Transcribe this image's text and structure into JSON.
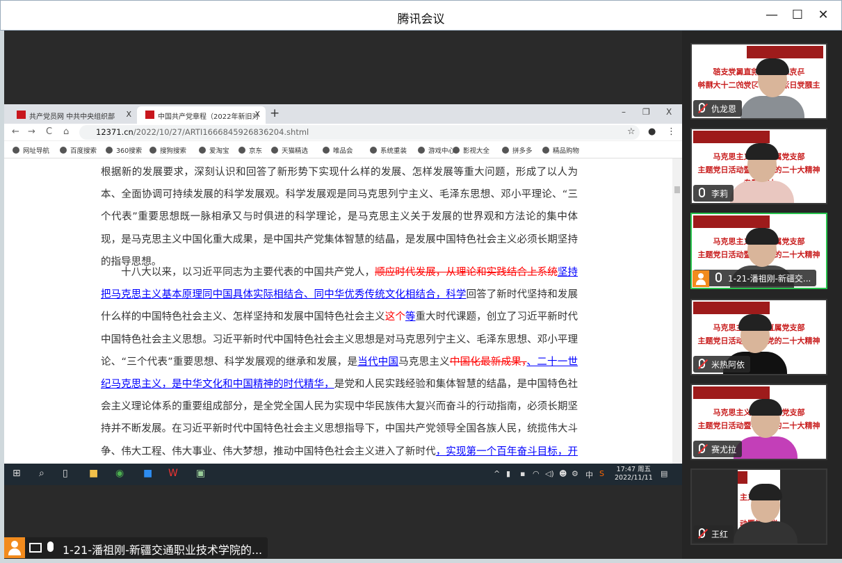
{
  "window": {
    "title": "腾讯会议",
    "minimize": "—",
    "maximize": "☐",
    "close": "✕"
  },
  "browser": {
    "tabs": [
      {
        "label": "共产党员网 中共中央组织部",
        "close": "X"
      },
      {
        "label": "中国共产党章程（2022年新旧对",
        "close": "X"
      }
    ],
    "new_tab": "+",
    "controls": {
      "minimize": "–",
      "restore": "❐",
      "close": "X"
    },
    "nav": {
      "back": "←",
      "forward": "→",
      "reload": "C",
      "home": "⌂"
    },
    "url_host": "12371.cn",
    "url_path": "/2022/10/27/ARTI1666845926836204.shtml",
    "star": "☆",
    "profile": "●",
    "menu": "⋮",
    "bookmarks": [
      "网址导航",
      "百度搜索",
      "360搜索",
      "搜狗搜索",
      "爱淘宝",
      "京东",
      "天猫精选",
      "唯品会",
      "系统重装",
      "游戏中心",
      "影视大全",
      "拼多多",
      "精品购物"
    ]
  },
  "document": {
    "paragraphs": [
      [
        {
          "t": "n",
          "text": "根据新的发展要求，深刻认识和回答了新形势下实现什么样的发展、怎样发展等重大问题，形成了以人为本、全面协调可持续发展的科学发展观。科学发展观是同马克思列宁主义、毛泽东思想、邓小平理论、“三个代表”重要思想既一脉相承又与时俱进的科学理论，是马克思主义关于发展的世界观和方法论的集中体现，是马克思主义中国化重大成果，是中国共产党集体智慧的结晶，是发展中国特色社会主义必须长期坚持的指导思想。"
        }
      ],
      [
        {
          "t": "n",
          "text": "十八大以来，以习近平同志为主要代表的中国共产党人，"
        },
        {
          "t": "del",
          "text": "顺应时代发展，从理论和实践结合上系统"
        },
        {
          "t": "ins",
          "text": "坚持把马克思主义基本原理同中国具体实际相结合、同中华优秀传统文化相结合，科学"
        },
        {
          "t": "n",
          "text": "回答了新时代坚持和发展什么样的中国特色社会主义、怎样坚持和发展中国特色社会主义"
        },
        {
          "t": "red",
          "text": "这个"
        },
        {
          "t": "ins",
          "text": "等"
        },
        {
          "t": "n",
          "text": "重大时代课题，创立了习近平新时代中国特色社会主义思想。习近平新时代中国特色社会主义思想是对马克思列宁主义、毛泽东思想、邓小平理论、“三个代表”重要思想、科学发展观的继承和发展，是"
        },
        {
          "t": "ins",
          "text": "当代中国"
        },
        {
          "t": "n",
          "text": "马克思主义"
        },
        {
          "t": "del",
          "text": "中国化最新成果，"
        },
        {
          "t": "ins",
          "text": "、二十一世纪马克思主义，是中华文化和中国精神的时代精华，"
        },
        {
          "t": "n",
          "text": "是党和人民实践经验和集体智慧的结晶，是中国特色社会主义理论体系的重要组成部分，是全党全国人民为实现中华民族伟大复兴而奋斗的行动指南，必须长期坚持并不断发展。在习近平新时代中国特色社会主义思想指导下，中国共产党领导全国各族人民，统揽伟大斗争、伟大工程、伟大事业、伟大梦想，推动中国特色社会主义进入了新时代"
        },
        {
          "t": "ins",
          "text": "，实现第一个百年奋斗目标，开启了实现第二个百年奋斗目标新征程"
        },
        {
          "t": "n",
          "text": "。"
        }
      ]
    ]
  },
  "taskbar": {
    "time": "17:47 周五",
    "date": "2022/11/11",
    "ime": "中"
  },
  "participants": [
    {
      "name": "仇龙恩",
      "muted": true,
      "slide": [
        "马克思主义学院直属党支部",
        "主题党日活动暨学习党的二十大精神"
      ],
      "shirt": "#8a8f94"
    },
    {
      "name": "李莉",
      "muted": false,
      "slide": [
        "马克思主义学院直属党支部",
        "主题党日活动暨学习党的二十大精神",
        "专题研讨"
      ],
      "shirt": "#e9c7c0"
    },
    {
      "name": "1-21-潘祖刚-新疆交...",
      "muted": false,
      "active": true,
      "slide": [
        "马克思主义学院直属党支部",
        "主题党日活动暨学习党的二十大精神"
      ],
      "shirt": "#4a4a4a"
    },
    {
      "name": "米热阿依",
      "muted": true,
      "slide": [
        "马克思主义学院直属党支部",
        "主题党日活动暨学习党的二十大精神"
      ],
      "shirt": "#111"
    },
    {
      "name": "赛尤拉",
      "muted": true,
      "slide": [
        "马克思主义学院直属党支部",
        "主题党日活动暨学习党的二十大精神"
      ],
      "shirt": "#c33fb8"
    },
    {
      "name": "王红",
      "muted": true,
      "slide": [
        "主义学院直属",
        "动暨学习党的",
        "专题研讨"
      ],
      "shirt": "#333"
    }
  ],
  "speaker": {
    "name": "1-21-潘祖刚-新疆交通职业技术学院的..."
  }
}
